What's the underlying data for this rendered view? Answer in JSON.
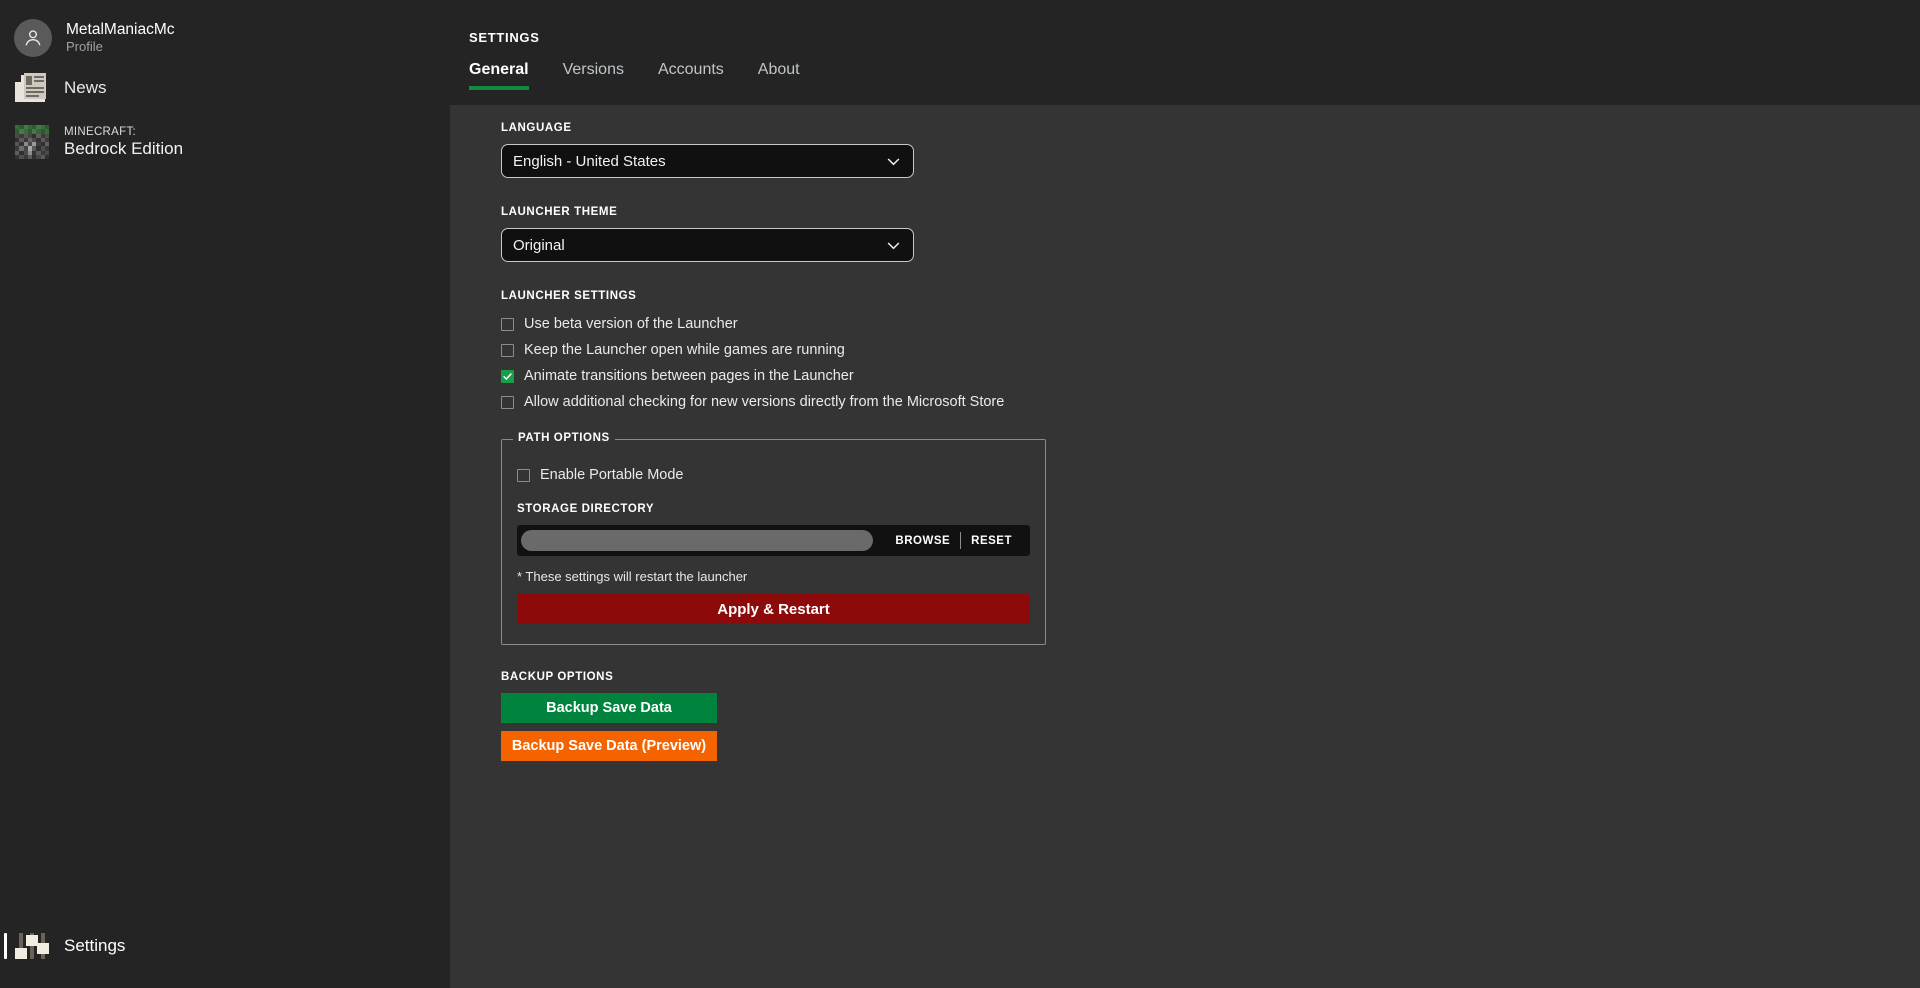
{
  "sidebar": {
    "profile": {
      "name": "MetalManiacMc",
      "subtitle": "Profile",
      "avatar_icon": "person-icon"
    },
    "items": [
      {
        "label": "News",
        "icon": "news-icon"
      },
      {
        "caps": "MINECRAFT:",
        "label": "Bedrock Edition",
        "icon": "minecraft-block-icon"
      }
    ],
    "bottom": {
      "label": "Settings",
      "icon": "sliders-icon",
      "active": true
    }
  },
  "header": {
    "title": "SETTINGS",
    "tabs": [
      {
        "label": "General",
        "active": true
      },
      {
        "label": "Versions",
        "active": false
      },
      {
        "label": "Accounts",
        "active": false
      },
      {
        "label": "About",
        "active": false
      }
    ]
  },
  "general": {
    "language": {
      "label": "LANGUAGE",
      "value": "English - United States",
      "chevron_icon": "chevron-down-icon"
    },
    "theme": {
      "label": "LAUNCHER THEME",
      "value": "Original",
      "chevron_icon": "chevron-down-icon"
    },
    "launcher_settings": {
      "label": "LAUNCHER SETTINGS",
      "options": [
        {
          "label": "Use beta version of the Launcher",
          "checked": false
        },
        {
          "label": "Keep the Launcher open while games are running",
          "checked": false
        },
        {
          "label": "Animate transitions between pages in the Launcher",
          "checked": true
        },
        {
          "label": "Allow additional checking for new versions directly from the Microsoft Store",
          "checked": false
        }
      ]
    },
    "path_options": {
      "legend": "PATH OPTIONS",
      "portable_mode": {
        "label": "Enable Portable Mode",
        "checked": false
      },
      "storage_directory": {
        "label": "STORAGE DIRECTORY",
        "value": "",
        "placeholder": "",
        "browse_label": "BROWSE",
        "reset_label": "RESET"
      },
      "note": "* These settings will restart the launcher",
      "apply_label": "Apply & Restart"
    },
    "backup_options": {
      "label": "BACKUP OPTIONS",
      "buttons": [
        {
          "label": "Backup Save Data",
          "color": "#00843d"
        },
        {
          "label": "Backup Save Data (Preview)",
          "color": "#f56300"
        }
      ]
    }
  },
  "colors": {
    "accent_green": "#128a3b",
    "apply_red": "#8c0a0a",
    "backup_green": "#00843d",
    "backup_orange": "#f56300",
    "sidebar_bg": "#242424",
    "panel_bg": "#343434"
  }
}
